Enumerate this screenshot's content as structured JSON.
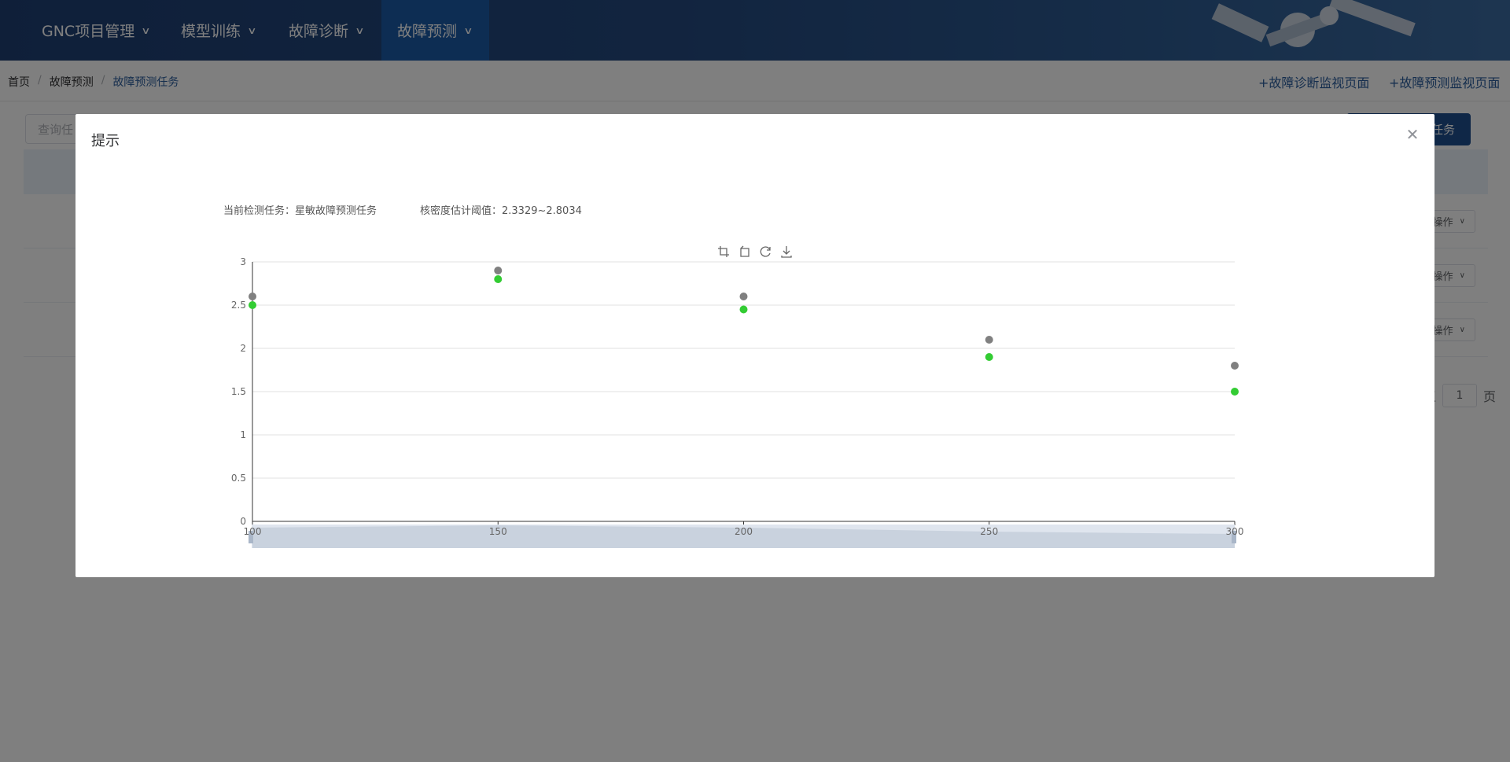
{
  "nav": {
    "items": [
      {
        "label": "GNC项目管理",
        "active": false
      },
      {
        "label": "模型训练",
        "active": false
      },
      {
        "label": "故障诊断",
        "active": false
      },
      {
        "label": "故障预测",
        "active": true
      }
    ]
  },
  "breadcrumb": {
    "home": "首页",
    "section": "故障预测",
    "current": "故障预测任务"
  },
  "top_links": {
    "diagnosis": "+故障诊断监视页面",
    "prediction": "+故障预测监视页面"
  },
  "page": {
    "query_placeholder": "查询任",
    "create_label": "任务",
    "rows": [
      {
        "op_label": "操作"
      },
      {
        "op_label": "操作"
      },
      {
        "op_label": "操作"
      }
    ],
    "pager": {
      "prefix": "王",
      "page": "1",
      "suffix": "页"
    }
  },
  "dialog": {
    "title": "提示",
    "close_icon": "close-icon",
    "task_label": "当前检测任务：星敏故障预测任务",
    "threshold_label": "核密度估计阈值：2.3329~2.8034"
  },
  "toolbox": {
    "icons": [
      "zoom-select-icon",
      "zoom-reset-icon",
      "restore-icon",
      "save-image-icon"
    ]
  },
  "chart_data": {
    "type": "scatter",
    "xlim": [
      100,
      300
    ],
    "ylim": [
      0,
      3
    ],
    "xticks": [
      100,
      150,
      200,
      250,
      300
    ],
    "yticks": [
      0,
      0.5,
      1,
      1.5,
      2,
      2.5,
      3
    ],
    "grid": true,
    "datazoom": true,
    "series": [
      {
        "color": "#808080",
        "x": [
          100,
          150,
          200,
          250,
          300
        ],
        "y": [
          2.6,
          2.9,
          2.6,
          2.1,
          1.8
        ]
      },
      {
        "color": "#33cc33",
        "x": [
          100,
          150,
          200,
          250,
          300
        ],
        "y": [
          2.5,
          2.8,
          2.45,
          1.9,
          1.5
        ]
      }
    ],
    "colors": {
      "grid": "#e0e0e0",
      "axis": "#333333"
    }
  }
}
